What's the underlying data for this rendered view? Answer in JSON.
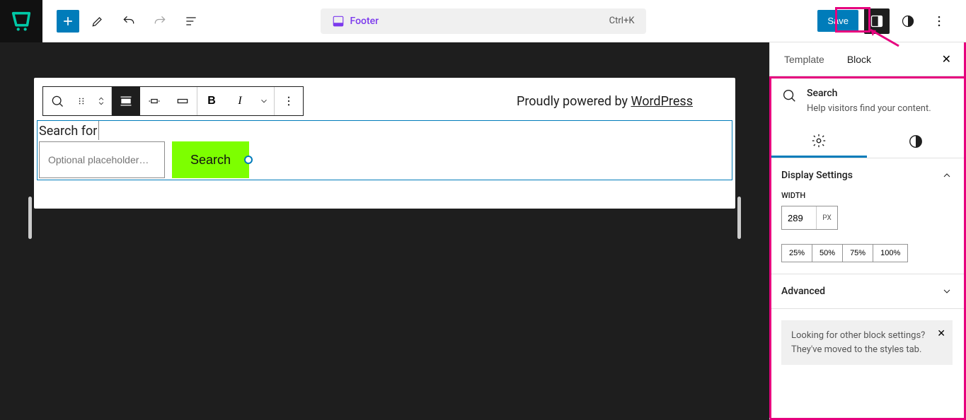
{
  "header": {
    "center_label": "Footer",
    "shortcut": "Ctrl+K",
    "save_label": "Save"
  },
  "canvas": {
    "powered_prefix": "Proudly powered by ",
    "powered_link": "WordPress",
    "search_label": "Search for",
    "search_placeholder": "Optional placeholder…",
    "search_button": "Search"
  },
  "sidebar": {
    "tabs": {
      "template": "Template",
      "block": "Block"
    },
    "block_info": {
      "title": "Search",
      "desc": "Help visitors find your content."
    },
    "display_settings": {
      "title": "Display Settings",
      "width_label": "Width",
      "width_value": "289",
      "width_unit": "PX",
      "percents": [
        "25%",
        "50%",
        "75%",
        "100%"
      ]
    },
    "advanced": "Advanced",
    "notice": "Looking for other block settings? They've moved to the styles tab."
  }
}
